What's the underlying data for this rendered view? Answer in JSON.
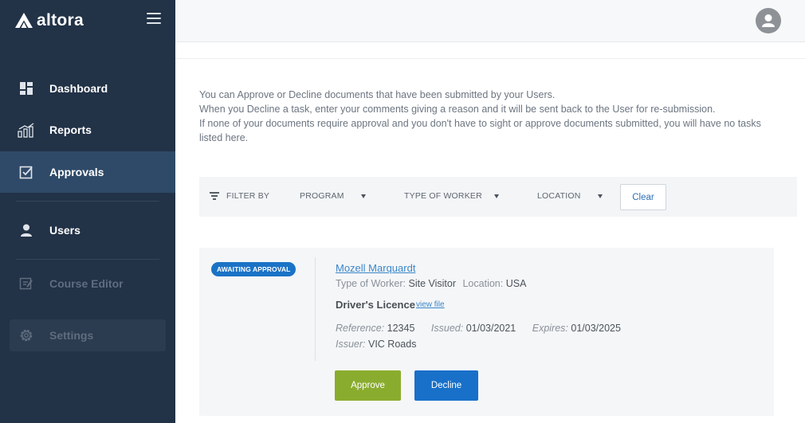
{
  "brand": {
    "name": "altora"
  },
  "sidebar": {
    "items": [
      {
        "key": "dashboard",
        "label": "Dashboard",
        "icon": "dashboard-icon",
        "active": false,
        "disabled": false
      },
      {
        "key": "reports",
        "label": "Reports",
        "icon": "bar-chart-icon",
        "active": false,
        "disabled": false
      },
      {
        "key": "approvals",
        "label": "Approvals",
        "icon": "checkbox-icon",
        "active": true,
        "disabled": false
      },
      {
        "key": "users",
        "label": "Users",
        "icon": "user-icon",
        "active": false,
        "disabled": false
      },
      {
        "key": "course_editor",
        "label": "Course Editor",
        "icon": "edit-icon",
        "active": false,
        "disabled": true
      },
      {
        "key": "settings",
        "label": "Settings",
        "icon": "gear-icon",
        "active": false,
        "disabled": true
      }
    ]
  },
  "intro": {
    "line1": "You can Approve or Decline documents that have been submitted by your Users.",
    "line2": "When you Decline a task, enter your comments giving a reason and it will be sent back to the User for re-submission.",
    "line3": "If none of your documents require approval and you don't have to sight or approve documents submitted, you will have no tasks listed here."
  },
  "filter": {
    "label": "FILTER BY",
    "program": "PROGRAM",
    "type_of_worker": "TYPE OF WORKER",
    "location": "LOCATION",
    "clear": "Clear"
  },
  "task": {
    "status": "AWAITING APPROVAL",
    "user_name": "Mozell Marquardt",
    "type_of_worker_label": "Type of Worker:",
    "type_of_worker": "Site Visitor",
    "location_label": "Location:",
    "location": "USA",
    "document": "Driver's Licence",
    "view_file": "view file",
    "reference_label": "Reference:",
    "reference": "12345",
    "issued_label": "Issued:",
    "issued": "01/03/2021",
    "expires_label": "Expires:",
    "expires": "01/03/2025",
    "issuer_label": "Issuer:",
    "issuer": "VIC Roads",
    "approve": "Approve",
    "decline": "Decline"
  },
  "colors": {
    "sidebar_bg": "#223247",
    "sidebar_active": "#2f4a68",
    "badge": "#1b73c6",
    "approve": "#8aac2e",
    "decline": "#1870c9",
    "link": "#3a86c9"
  }
}
